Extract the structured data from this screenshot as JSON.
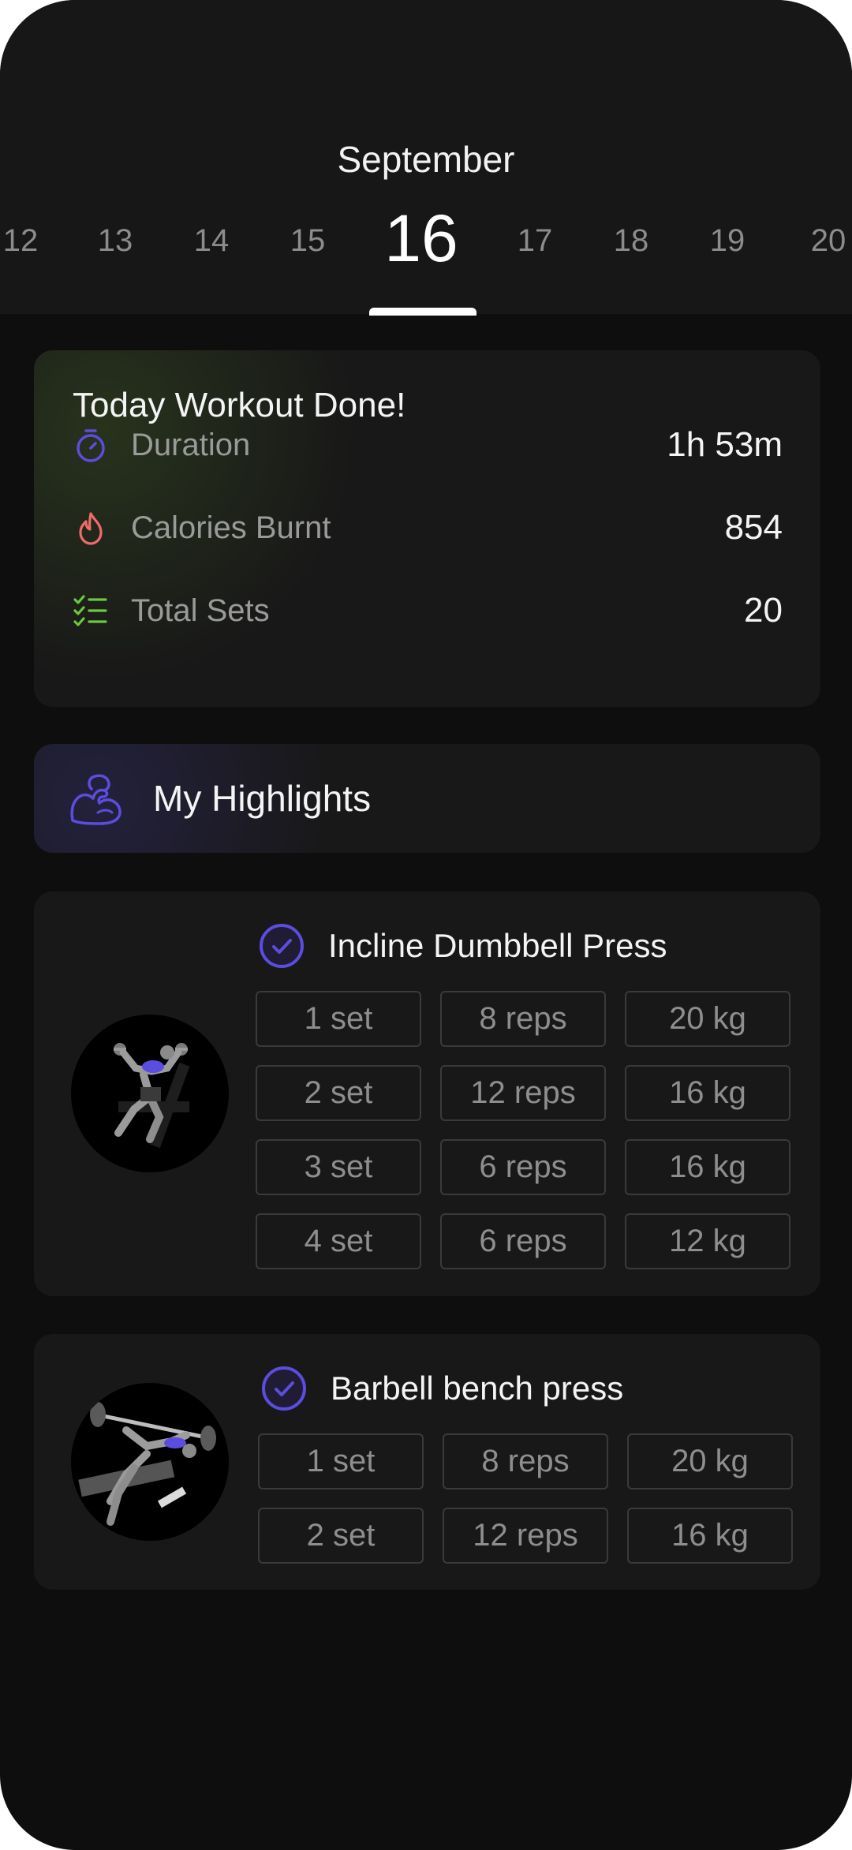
{
  "calendar": {
    "month": "September",
    "days": [
      "12",
      "13",
      "14",
      "15",
      "16",
      "17",
      "18",
      "19",
      "20"
    ],
    "selected_day": "16"
  },
  "summary": {
    "title": "Today Workout Done!",
    "stats": [
      {
        "label": "Duration",
        "value": "1h 53m",
        "icon": "stopwatch-icon",
        "color": "#5b4de0"
      },
      {
        "label": "Calories Burnt",
        "value": "854",
        "icon": "flame-icon",
        "color": "#ef6b6b"
      },
      {
        "label": "Total Sets",
        "value": "20",
        "icon": "checklist-icon",
        "color": "#6bc93c"
      }
    ]
  },
  "highlights": {
    "title": "My Highlights",
    "icon": "flexed-bicep-icon",
    "color": "#5b4de0"
  },
  "exercises": [
    {
      "name": "Incline Dumbbell Press",
      "sets": [
        {
          "set": "1 set",
          "reps": "8 reps",
          "weight": "20 kg"
        },
        {
          "set": "2 set",
          "reps": "12 reps",
          "weight": "16 kg"
        },
        {
          "set": "3 set",
          "reps": "6 reps",
          "weight": "16 kg"
        },
        {
          "set": "4 set",
          "reps": "6 reps",
          "weight": "12 kg"
        }
      ]
    },
    {
      "name": "Barbell bench press",
      "sets": [
        {
          "set": "1 set",
          "reps": "8 reps",
          "weight": "20 kg"
        },
        {
          "set": "2 set",
          "reps": "12 reps",
          "weight": "16 kg"
        }
      ]
    }
  ],
  "colors": {
    "accent": "#5b4de0",
    "background": "#0e0e0e",
    "card": "#181818"
  }
}
